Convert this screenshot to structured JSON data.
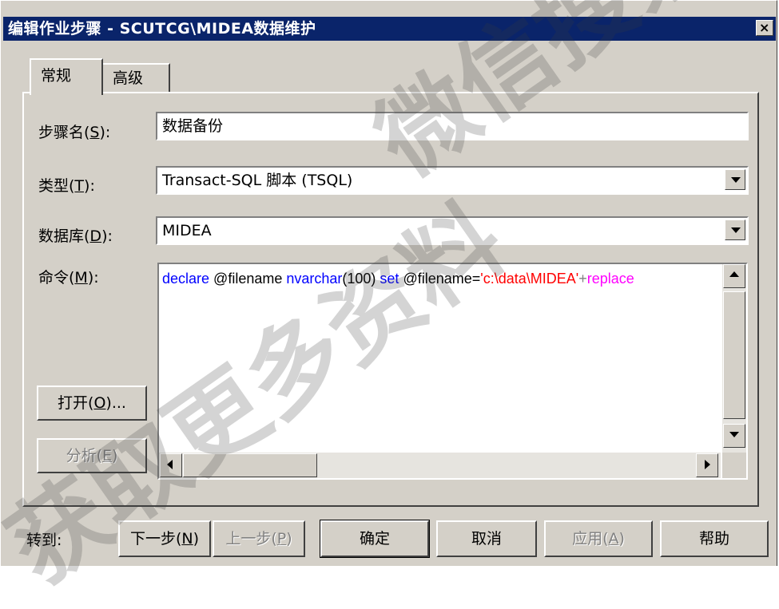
{
  "window": {
    "title": "编辑作业步骤 - SCUTCG\\MIDEA数据维护",
    "close_glyph": "×"
  },
  "tabs": [
    {
      "label": "常规"
    },
    {
      "label": "高级"
    }
  ],
  "fields": {
    "step_name": {
      "label_prefix": "步骤名(",
      "hotkey": "S",
      "label_suffix": "):",
      "value": "数据备份"
    },
    "type": {
      "label_prefix": "类型(",
      "hotkey": "T",
      "label_suffix": "):",
      "value": "Transact-SQL 脚本 (TSQL)"
    },
    "database": {
      "label_prefix": "数据库(",
      "hotkey": "D",
      "label_suffix": "):",
      "value": "MIDEA"
    },
    "command": {
      "label_prefix": "命令(",
      "hotkey": "M",
      "label_suffix": "):",
      "code": {
        "kw_declare": "declare",
        "var1": " @filename ",
        "kw_type": "nvarchar",
        "len": "(100) ",
        "kw_set": "set",
        "assign": " @filename=",
        "str": "'c:\\data\\MIDEA'",
        "plus": "+",
        "fn": "replace"
      }
    }
  },
  "side_buttons": {
    "open": {
      "prefix": "打开(",
      "hotkey": "O",
      "suffix": ")..."
    },
    "parse": {
      "prefix": "分析(",
      "hotkey": "E",
      "suffix": ")"
    }
  },
  "footer": {
    "goto_label": "转到:",
    "next": {
      "prefix": "下一步(",
      "hotkey": "N",
      "suffix": ")"
    },
    "prev": {
      "prefix": "上一步(",
      "hotkey": "P",
      "suffix": ")"
    },
    "ok": "确定",
    "cancel": "取消",
    "apply": {
      "prefix": "应用(",
      "hotkey": "A",
      "suffix": ")"
    },
    "help": "帮助"
  },
  "colors": {
    "titlebar": "#0a246a",
    "face": "#d4d0c8",
    "sql_keyword": "#0000ff",
    "sql_string": "#ff0000",
    "sql_function": "#ff00ff",
    "sql_operator": "#808080"
  },
  "watermark": {
    "line1": "微信搜索",
    "line2": "获取更多资料"
  }
}
